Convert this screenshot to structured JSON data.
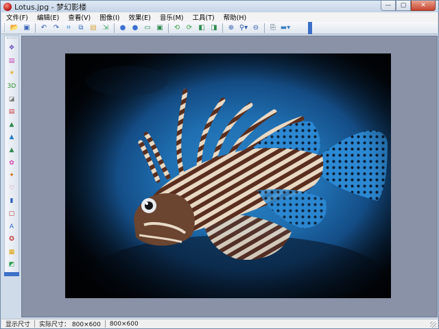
{
  "window": {
    "title": "Lotus.jpg - 梦幻影楼",
    "controls": {
      "minimize": "—",
      "maximize": "▢",
      "close": "✕"
    }
  },
  "menu": [
    "文件(F)",
    "编辑(E)",
    "查看(V)",
    "图像(I)",
    "效果(E)",
    "音乐(M)",
    "工具(T)",
    "帮助(H)"
  ],
  "toolbar": {
    "buttons": [
      {
        "icon": "open-folder-icon",
        "glyph": "📂",
        "color": "#e5b63a"
      },
      {
        "icon": "save-icon",
        "glyph": "▣",
        "color": "#3b64b5"
      },
      {
        "sep": true
      },
      {
        "icon": "undo-icon",
        "glyph": "↶",
        "color": "#2c58b0"
      },
      {
        "icon": "redo-icon",
        "glyph": "↷",
        "color": "#2c58b0"
      },
      {
        "icon": "crop-icon",
        "glyph": "⌗",
        "color": "#2d7fbf"
      },
      {
        "icon": "copy-icon",
        "glyph": "⧉",
        "color": "#3a6cc0"
      },
      {
        "icon": "paste-icon",
        "glyph": "▤",
        "color": "#d9a53a"
      },
      {
        "icon": "import-icon",
        "glyph": "⇲",
        "color": "#3aa15a"
      },
      {
        "sep": true
      },
      {
        "icon": "circle-blue-icon",
        "glyph": "●",
        "color": "#3b6fd1"
      },
      {
        "icon": "circle-blue-2-icon",
        "glyph": "●",
        "color": "#3b6fd1"
      },
      {
        "icon": "fit-window-icon",
        "glyph": "▭",
        "color": "#2f8a4f"
      },
      {
        "icon": "slideshow-icon",
        "glyph": "▣",
        "color": "#2f8a4f"
      },
      {
        "sep": true
      },
      {
        "icon": "rotate-left-icon",
        "glyph": "⟲",
        "color": "#3aa040"
      },
      {
        "icon": "rotate-right-icon",
        "glyph": "⟳",
        "color": "#3aa040"
      },
      {
        "icon": "flip-icon",
        "glyph": "◧",
        "color": "#2f8a4f"
      },
      {
        "icon": "mirror-icon",
        "glyph": "◨",
        "color": "#2f8a4f"
      },
      {
        "sep": true
      },
      {
        "icon": "zoom-in-icon",
        "glyph": "⊕",
        "color": "#2b58a8"
      },
      {
        "icon": "zoom-dropdown-icon",
        "glyph": "⚲▾",
        "color": "#2b58a8"
      },
      {
        "icon": "zoom-out-icon",
        "glyph": "⊖",
        "color": "#2b58a8"
      },
      {
        "sep": true
      },
      {
        "icon": "properties-icon",
        "glyph": "⎘",
        "color": "#34495e"
      },
      {
        "icon": "wallpaper-icon",
        "glyph": "▬▾",
        "color": "#3b7fc4"
      }
    ]
  },
  "sidebar": {
    "buttons": [
      {
        "icon": "move-icon",
        "glyph": "✥",
        "color": "#5a3fb5"
      },
      {
        "icon": "frame-pink-icon",
        "glyph": "▤",
        "color": "#c33fb0"
      },
      {
        "icon": "sun-icon",
        "glyph": "☀",
        "color": "#e0a400"
      },
      {
        "icon": "3d-icon",
        "glyph": "3D",
        "color": "#2f8f2f"
      },
      {
        "icon": "image-adjust-icon",
        "glyph": "◪",
        "color": "#7a7a7a"
      },
      {
        "icon": "layer-icon",
        "glyph": "▤",
        "color": "#cc3a3a"
      },
      {
        "icon": "landscape-icon",
        "glyph": "▲",
        "color": "#2f8a4f"
      },
      {
        "icon": "landscape-2-icon",
        "glyph": "▲",
        "color": "#2a7fc4"
      },
      {
        "icon": "landscape-3-icon",
        "glyph": "▲",
        "color": "#2f8a4f"
      },
      {
        "icon": "colorful-icon",
        "glyph": "✿",
        "color": "#d03ab0"
      },
      {
        "icon": "star-icon",
        "glyph": "✦",
        "color": "#d06a10"
      },
      {
        "icon": "heart-icon",
        "glyph": "♡",
        "color": "#d04a8a"
      },
      {
        "icon": "bars-icon",
        "glyph": "▮",
        "color": "#2f5fbf"
      },
      {
        "icon": "frame-icon",
        "glyph": "▢",
        "color": "#b02a2a"
      },
      {
        "icon": "text-icon",
        "glyph": "A",
        "color": "#2b5bd0"
      },
      {
        "icon": "sticker-icon",
        "glyph": "✪",
        "color": "#c03030"
      },
      {
        "icon": "gradient-icon",
        "glyph": "▦",
        "color": "#e0a000"
      },
      {
        "icon": "effect-icon",
        "glyph": "◩",
        "color": "#2f9f4f"
      }
    ]
  },
  "status": {
    "display_size": "显示尺寸",
    "actual_size_label": "实际尺寸：",
    "actual_size": "800×600",
    "display_value": "800×600"
  }
}
